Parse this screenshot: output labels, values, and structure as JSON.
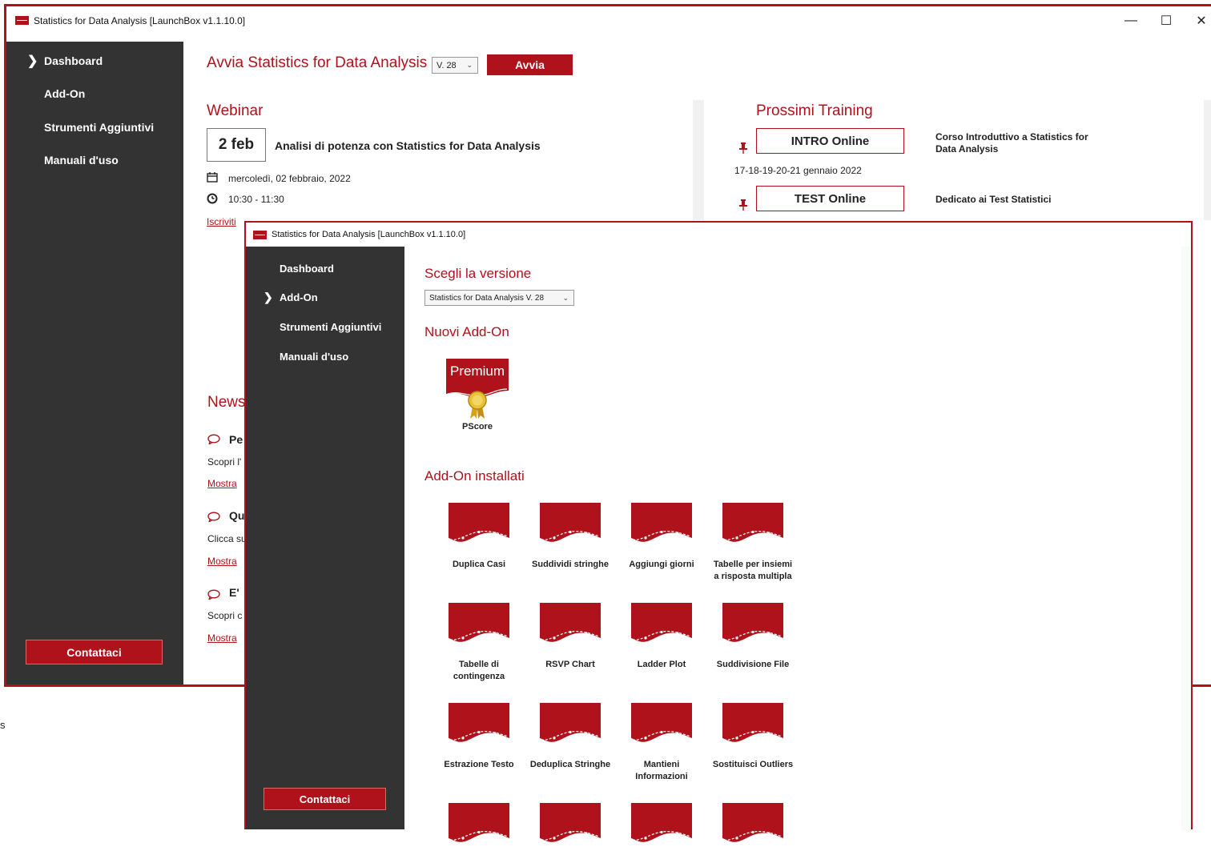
{
  "win1": {
    "title": "Statistics for Data Analysis [LaunchBox v1.1.10.0]",
    "controls": {
      "minimize": "—",
      "maximize": "☐",
      "close": "✕"
    },
    "sidebar": {
      "items": [
        {
          "label": "Dashboard",
          "active": true
        },
        {
          "label": "Add-On"
        },
        {
          "label": "Strumenti Aggiuntivi"
        },
        {
          "label": "Manuali d'uso"
        }
      ],
      "contact": "Contattaci"
    },
    "launch": {
      "title": "Avvia Statistics for Data Analysis",
      "version": "V. 28",
      "button": "Avvia"
    },
    "webinar": {
      "heading": "Webinar",
      "date_badge": "2 feb",
      "title": "Analisi di potenza con Statistics for Data Analysis",
      "date_text": "mercoledì, 02 febbraio, 2022",
      "time_text": "10:30 - 11:30",
      "register": "Iscriviti"
    },
    "training": {
      "heading": "Prossimi Training",
      "items": [
        {
          "button": "INTRO Online",
          "desc": "Corso Introduttivo a Statistics for Data Analysis",
          "dates": "17-18-19-20-21 gennaio 2022"
        },
        {
          "button": "TEST Online",
          "desc": "Dedicato ai Test Statistici"
        }
      ]
    },
    "news": {
      "heading": "News",
      "items": [
        {
          "title": "Pe",
          "text": "Scopri l'",
          "link": "Mostra"
        },
        {
          "title": "Qu",
          "text": "Clicca su",
          "link": "Mostra"
        },
        {
          "title": "E'",
          "text": "Scopri c",
          "link": "Mostra"
        }
      ]
    }
  },
  "win2": {
    "title": "Statistics for Data Analysis [LaunchBox v1.1.10.0]",
    "sidebar": {
      "items": [
        {
          "label": "Dashboard"
        },
        {
          "label": "Add-On",
          "active": true
        },
        {
          "label": "Strumenti Aggiuntivi"
        },
        {
          "label": "Manuali d'uso"
        }
      ],
      "contact": "Contattaci"
    },
    "version_heading": "Scegli la versione",
    "version_select": "Statistics for Data Analysis V. 28",
    "new_heading": "Nuovi Add-On",
    "new_addon": {
      "banner": "Premium",
      "label": "PScore"
    },
    "installed_heading": "Add-On installati",
    "installed": [
      "Duplica Casi",
      "Suddividi stringhe",
      "Aggiungi giorni",
      "Tabelle per insiemi a risposta multipla",
      "Tabelle di contingenza",
      "RSVP Chart",
      "Ladder Plot",
      "Suddivisione File",
      "Estrazione Testo",
      "Deduplica Stringhe",
      "Mantieni Informazioni",
      "Sostituisci Outliers",
      "",
      "",
      "",
      ""
    ]
  },
  "colors": {
    "accent": "#b0121b",
    "sidebar": "#333333"
  },
  "background_fragment": "s"
}
